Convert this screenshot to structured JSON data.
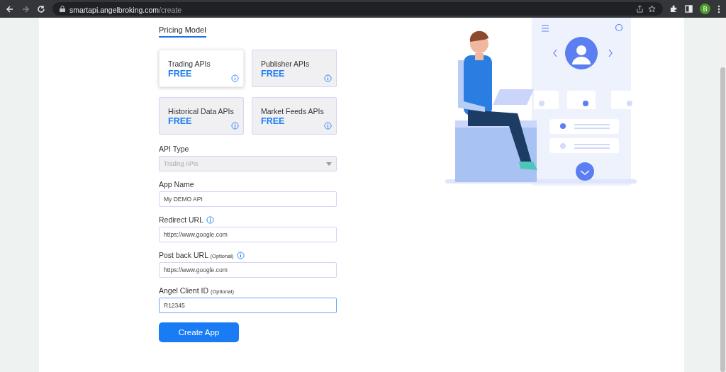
{
  "browser": {
    "url_host": "smartapi.angelbroking.com",
    "url_path": "/create",
    "profile_initial": "B"
  },
  "section_title": "Pricing Model",
  "plans": [
    {
      "name": "Trading APIs",
      "price": "FREE",
      "selected": true
    },
    {
      "name": "Publisher APIs",
      "price": "FREE",
      "selected": false
    },
    {
      "name": "Historical Data APIs",
      "price": "FREE",
      "selected": false
    },
    {
      "name": "Market Feeds APIs",
      "price": "FREE",
      "selected": false
    }
  ],
  "fields": [
    {
      "kind": "select",
      "label": "API Type",
      "value": "Trading APIs",
      "disabled": true
    },
    {
      "kind": "input",
      "label": "App Name",
      "value": "My DEMO API",
      "focused": false
    },
    {
      "kind": "input",
      "label": "Redirect URL",
      "info": true,
      "value": "https://www.google.com",
      "focused": false
    },
    {
      "kind": "input",
      "label": "Post back URL",
      "optional": "(Optional)",
      "info": true,
      "value": "https://www.google.com",
      "focused": false
    },
    {
      "kind": "input",
      "label": "Angel Client ID",
      "optional": "(Optional)",
      "value": "R12345",
      "focused": true
    }
  ],
  "submit": "Create App"
}
